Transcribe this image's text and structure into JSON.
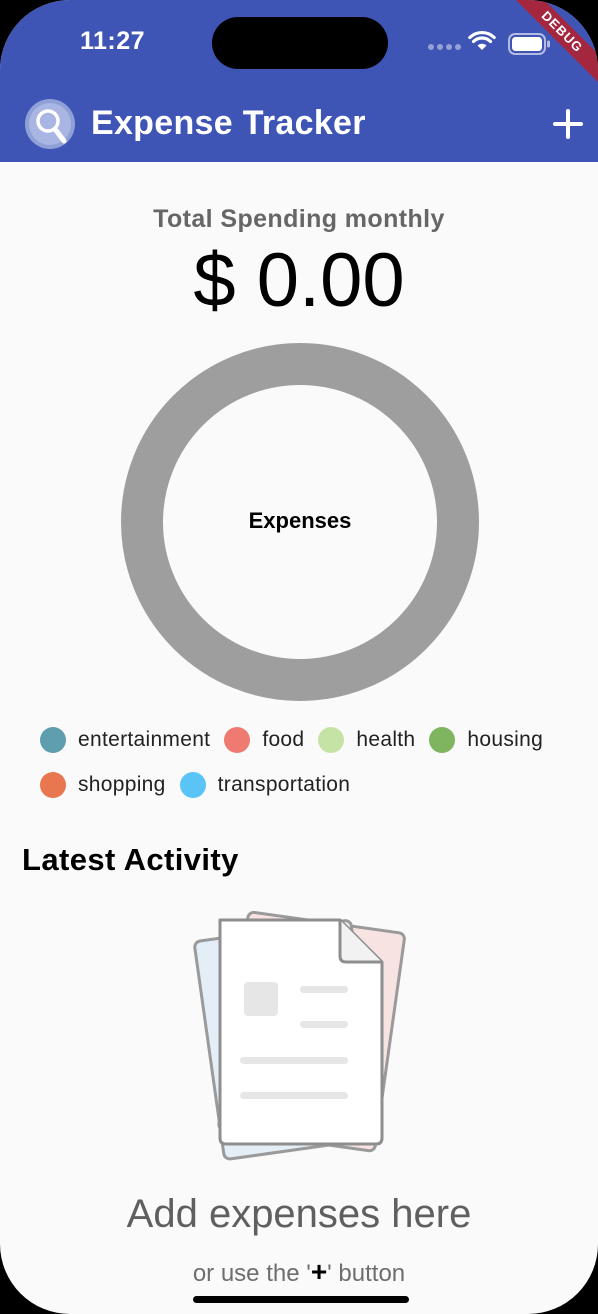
{
  "status_bar": {
    "time": "11:27",
    "debug_label": "DEBUG"
  },
  "app_bar": {
    "title": "Expense Tracker",
    "logo_icon": "magnifier-icon",
    "add_icon": "plus-icon",
    "background_color": "#3f55b5"
  },
  "summary": {
    "label": "Total Spending monthly",
    "value": "$ 0.00"
  },
  "chart_data": {
    "type": "pie",
    "title": "Expenses",
    "categories": [
      "entertainment",
      "food",
      "health",
      "housing",
      "shopping",
      "transportation"
    ],
    "values": [
      0,
      0,
      0,
      0,
      0,
      0
    ],
    "empty_color": "#9e9e9e",
    "colors": [
      "#5f9eae",
      "#ef7a72",
      "#c5e3a5",
      "#80b560",
      "#e8774f",
      "#5ac4f7"
    ],
    "legend_position": "bottom"
  },
  "legend": {
    "row1": [
      {
        "label": "entertainment",
        "color": "#5f9eae"
      },
      {
        "label": "food",
        "color": "#ef7a72"
      },
      {
        "label": "health",
        "color": "#c5e3a5"
      },
      {
        "label": "housing",
        "color": "#80b560"
      }
    ],
    "row2": [
      {
        "label": "shopping",
        "color": "#e8774f"
      },
      {
        "label": "transportation",
        "color": "#5ac4f7"
      }
    ]
  },
  "activity": {
    "title": "Latest Activity",
    "empty_icon": "documents-icon",
    "empty_title": "Add expenses here",
    "empty_sub_prefix": "or use the '",
    "empty_sub_glyph": "+",
    "empty_sub_suffix": "' button"
  }
}
